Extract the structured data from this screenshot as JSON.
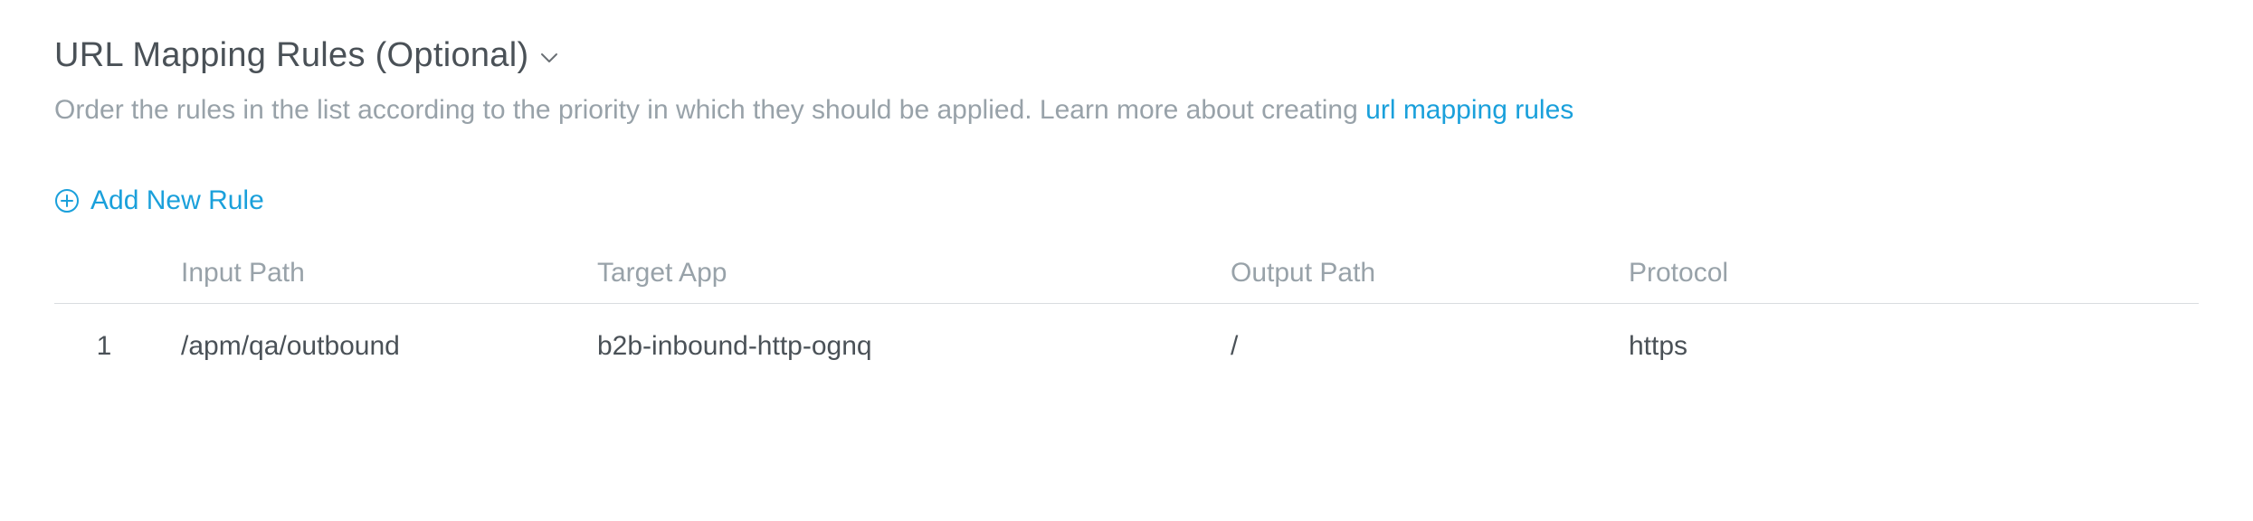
{
  "section": {
    "title": "URL Mapping Rules (Optional)",
    "description_before_link": "Order the rules in the list according to the priority in which they should be applied. Learn more about creating ",
    "link_text": "url mapping rules"
  },
  "actions": {
    "add_new_rule": "Add New Rule"
  },
  "table": {
    "headers": {
      "input_path": "Input Path",
      "target_app": "Target App",
      "output_path": "Output Path",
      "protocol": "Protocol"
    },
    "rows": [
      {
        "index": "1",
        "input_path": "/apm/qa/outbound",
        "target_app": "b2b-inbound-http-ognq",
        "output_path": "/",
        "protocol": "https"
      }
    ]
  }
}
